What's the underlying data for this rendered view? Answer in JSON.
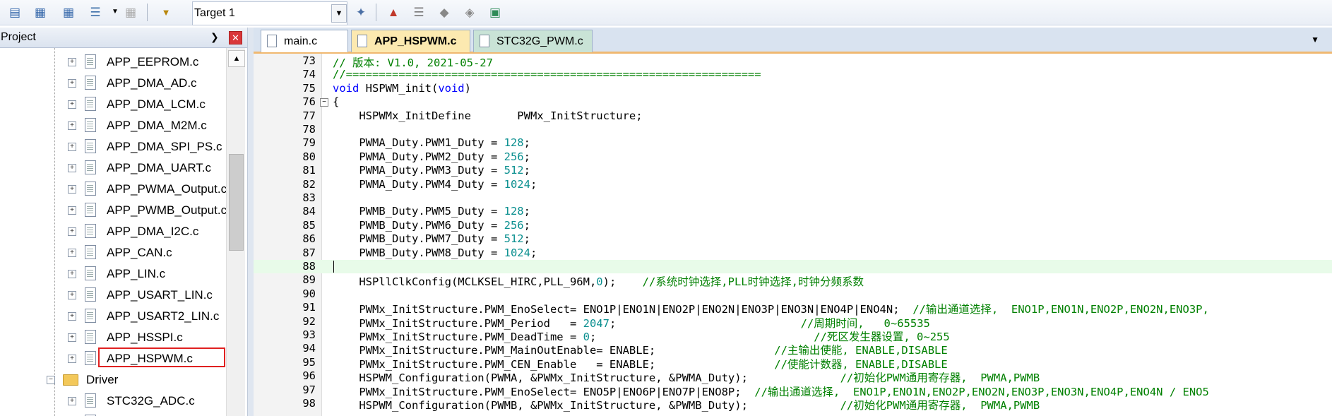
{
  "toolbar": {
    "target_label": "Target 1",
    "icons": [
      "translate-icon",
      "build-icon",
      "rebuild-icon",
      "batch-build-icon",
      "stop-build-icon",
      "load-icon",
      "wand-icon",
      "manage-project-icon",
      "manage-books-icon",
      "manage-components-icon",
      "rte-icon",
      "pack-installer-icon"
    ]
  },
  "project": {
    "title": "Project",
    "files": [
      "APP_EEPROM.c",
      "APP_DMA_AD.c",
      "APP_DMA_LCM.c",
      "APP_DMA_M2M.c",
      "APP_DMA_SPI_PS.c",
      "APP_DMA_UART.c",
      "APP_PWMA_Output.c",
      "APP_PWMB_Output.c",
      "APP_DMA_I2C.c",
      "APP_CAN.c",
      "APP_LIN.c",
      "APP_USART_LIN.c",
      "APP_USART2_LIN.c",
      "APP_HSSPI.c",
      "APP_HSPWM.c"
    ],
    "folder": "Driver",
    "driver_file": "STC32G_ADC.c"
  },
  "tabs": [
    "main.c",
    "APP_HSPWM.c",
    "STC32G_PWM.c"
  ],
  "editor": {
    "lines": [
      {
        "n": "73",
        "t": "// 版本: V1.0, 2021-05-27"
      },
      {
        "n": "74",
        "t": "//==============================================================="
      },
      {
        "n": "75",
        "t": "void HSPWM_init(void)"
      },
      {
        "n": "76",
        "t": "{"
      },
      {
        "n": "77",
        "t": "    HSPWMx_InitDefine       PWMx_InitStructure;"
      },
      {
        "n": "78",
        "t": ""
      },
      {
        "n": "79",
        "t": "    PWMA_Duty.PWM1_Duty = 128;"
      },
      {
        "n": "80",
        "t": "    PWMA_Duty.PWM2_Duty = 256;"
      },
      {
        "n": "81",
        "t": "    PWMA_Duty.PWM3_Duty = 512;"
      },
      {
        "n": "82",
        "t": "    PWMA_Duty.PWM4_Duty = 1024;"
      },
      {
        "n": "83",
        "t": ""
      },
      {
        "n": "84",
        "t": "    PWMB_Duty.PWM5_Duty = 128;"
      },
      {
        "n": "85",
        "t": "    PWMB_Duty.PWM6_Duty = 256;"
      },
      {
        "n": "86",
        "t": "    PWMB_Duty.PWM7_Duty = 512;"
      },
      {
        "n": "87",
        "t": "    PWMB_Duty.PWM8_Duty = 1024;"
      },
      {
        "n": "88",
        "t": ""
      },
      {
        "n": "89",
        "t": "    HSPllClkConfig(MCLKSEL_HIRC,PLL_96M,0);    //系统时钟选择,PLL时钟选择,时钟分频系数"
      },
      {
        "n": "90",
        "t": ""
      },
      {
        "n": "91",
        "t": "    PWMx_InitStructure.PWM_EnoSelect= ENO1P|ENO1N|ENO2P|ENO2N|ENO3P|ENO3N|ENO4P|ENO4N;  //输出通道选择,  ENO1P,ENO1N,ENO2P,ENO2N,ENO3P,"
      },
      {
        "n": "92",
        "t": "    PWMx_InitStructure.PWM_Period   = 2047;                            //周期时间,   0~65535"
      },
      {
        "n": "93",
        "t": "    PWMx_InitStructure.PWM_DeadTime = 0;                                 //死区发生器设置, 0~255"
      },
      {
        "n": "94",
        "t": "    PWMx_InitStructure.PWM_MainOutEnable= ENABLE;                  //主输出使能, ENABLE,DISABLE"
      },
      {
        "n": "95",
        "t": "    PWMx_InitStructure.PWM_CEN_Enable   = ENABLE;                  //使能计数器, ENABLE,DISABLE"
      },
      {
        "n": "96",
        "t": "    HSPWM_Configuration(PWMA, &PWMx_InitStructure, &PWMA_Duty);              //初始化PWM通用寄存器,  PWMA,PWMB"
      },
      {
        "n": "97",
        "t": "    PWMx_InitStructure.PWM_EnoSelect= ENO5P|ENO6P|ENO7P|ENO8P;  //输出通道选择,  ENO1P,ENO1N,ENO2P,ENO2N,ENO3P,ENO3N,ENO4P,ENO4N / ENO5"
      },
      {
        "n": "98",
        "t": "    HSPWM_Configuration(PWMB, &PWMx_InitStructure, &PWMB_Duty);              //初始化PWM通用寄存器,  PWMA,PWMB"
      }
    ]
  }
}
